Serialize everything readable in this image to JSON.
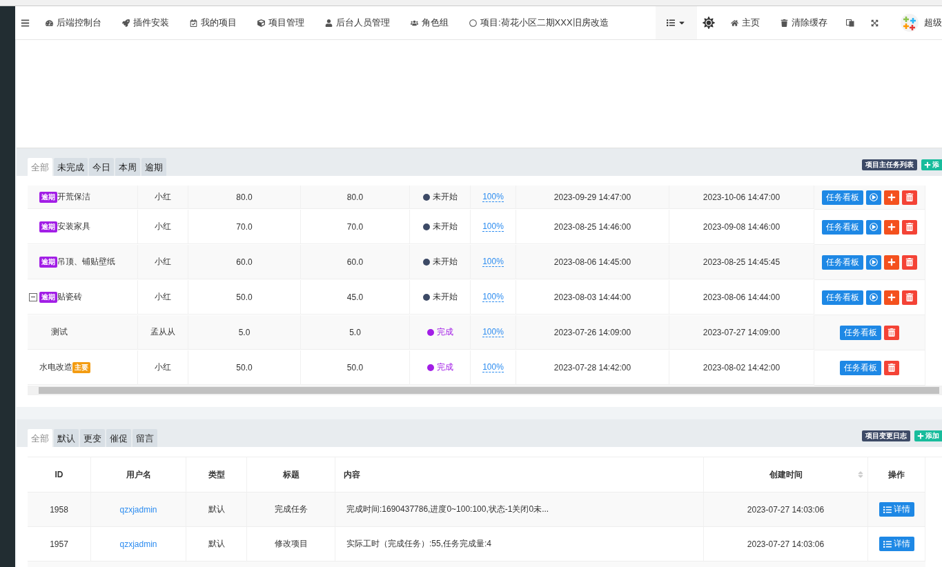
{
  "nav": {
    "items": [
      {
        "label": "后端控制台"
      },
      {
        "label": "插件安装"
      },
      {
        "label": "我的项目"
      },
      {
        "label": "项目管理"
      },
      {
        "label": "后台人员管理"
      },
      {
        "label": "角色组"
      },
      {
        "label": "项目:荷花小区二期XXX旧房改造"
      }
    ],
    "right_items": [
      {
        "label": "主页"
      },
      {
        "label": "清除缓存"
      }
    ],
    "user": "超级"
  },
  "tasks": {
    "tabs": [
      {
        "label": "全部",
        "selected": true
      },
      {
        "label": "未完成",
        "selected": false
      },
      {
        "label": "今日",
        "selected": false
      },
      {
        "label": "本周",
        "selected": false
      },
      {
        "label": "逾期",
        "selected": false
      }
    ],
    "title_badge": "项目主任务列表",
    "add_button": "添",
    "rows": [
      {
        "name": "开荒保洁",
        "tag": {
          "label": "逾期",
          "color": "#a21ee6"
        },
        "owner": "小红",
        "planned": "80.0",
        "actual": "80.0",
        "status": {
          "label": "未开始",
          "color": "#3d4a66"
        },
        "progress": "100%",
        "start": "2023-09-29 14:47:00",
        "end": "2023-10-06 14:47:00",
        "board": "任务看板",
        "actions": [
          {
            "kind": "play"
          },
          {
            "kind": "add"
          },
          {
            "kind": "delete"
          }
        ]
      },
      {
        "name": "安装家具",
        "tag": {
          "label": "逾期",
          "color": "#a21ee6"
        },
        "owner": "小红",
        "planned": "70.0",
        "actual": "70.0",
        "status": {
          "label": "未开始",
          "color": "#3d4a66"
        },
        "progress": "100%",
        "start": "2023-08-25 14:46:00",
        "end": "2023-09-08 14:46:00",
        "board": "任务看板",
        "actions": [
          {
            "kind": "play"
          },
          {
            "kind": "add"
          },
          {
            "kind": "delete"
          }
        ]
      },
      {
        "name": "吊顶、铺贴壁纸",
        "tag": {
          "label": "逾期",
          "color": "#a21ee6"
        },
        "owner": "小红",
        "planned": "60.0",
        "actual": "60.0",
        "status": {
          "label": "未开始",
          "color": "#3d4a66"
        },
        "progress": "100%",
        "start": "2023-08-06 14:45:00",
        "end": "2023-08-25 14:45:45",
        "board": "任务看板",
        "actions": [
          {
            "kind": "play"
          },
          {
            "kind": "add"
          },
          {
            "kind": "delete"
          }
        ]
      },
      {
        "name": "贴瓷砖",
        "tag": {
          "label": "逾期",
          "color": "#a21ee6"
        },
        "owner": "小红",
        "planned": "50.0",
        "actual": "45.0",
        "status": {
          "label": "未开始",
          "color": "#3d4a66"
        },
        "progress": "100%",
        "start": "2023-08-03 14:44:00",
        "end": "2023-08-06 14:44:00",
        "board": "任务看板",
        "actions": [
          {
            "kind": "play"
          },
          {
            "kind": "add"
          },
          {
            "kind": "delete"
          }
        ],
        "expanded": true,
        "children": [
          {
            "name": "测试",
            "owner": "孟从从",
            "planned": "5.0",
            "actual": "5.0",
            "status": {
              "label": "完成",
              "color": "#a21ee6"
            },
            "progress": "100%",
            "start": "2023-07-26 14:09:00",
            "end": "2023-07-27 14:09:00",
            "board": "任务看板",
            "actions": [
              {
                "kind": "delete"
              }
            ]
          }
        ]
      },
      {
        "name": "水电改造",
        "tag_after": {
          "label": "主要",
          "color": "#f39c12"
        },
        "owner": "小红",
        "planned": "50.0",
        "actual": "50.0",
        "status": {
          "label": "完成",
          "color": "#a21ee6"
        },
        "progress": "100%",
        "start": "2023-07-28 14:42:00",
        "end": "2023-08-02 14:42:00",
        "board": "任务看板",
        "actions": [
          {
            "kind": "delete"
          }
        ]
      }
    ]
  },
  "log": {
    "tabs": [
      {
        "label": "全部",
        "selected": true
      },
      {
        "label": "默认",
        "selected": false
      },
      {
        "label": "更变",
        "selected": false
      },
      {
        "label": "催促",
        "selected": false
      },
      {
        "label": "留言",
        "selected": false
      }
    ],
    "title_badge": "项目变更日志",
    "add_button": "添加",
    "columns": [
      "ID",
      "用户名",
      "类型",
      "标题",
      "内容",
      "创建时间",
      "操作"
    ],
    "rows": [
      {
        "id": "1958",
        "user": "qzxjadmin",
        "type": "默认",
        "title": "完成任务",
        "content": "完成时间:1690437786,进度0~100:100,状态-1关闭0未...",
        "created": "2023-07-27 14:03:06",
        "action": "详情"
      },
      {
        "id": "1957",
        "user": "qzxjadmin",
        "type": "默认",
        "title": "修改项目",
        "content": "实际工时（完成任务）:55,任务完成量:4",
        "created": "2023-07-27 14:03:06",
        "action": "详情"
      }
    ]
  }
}
